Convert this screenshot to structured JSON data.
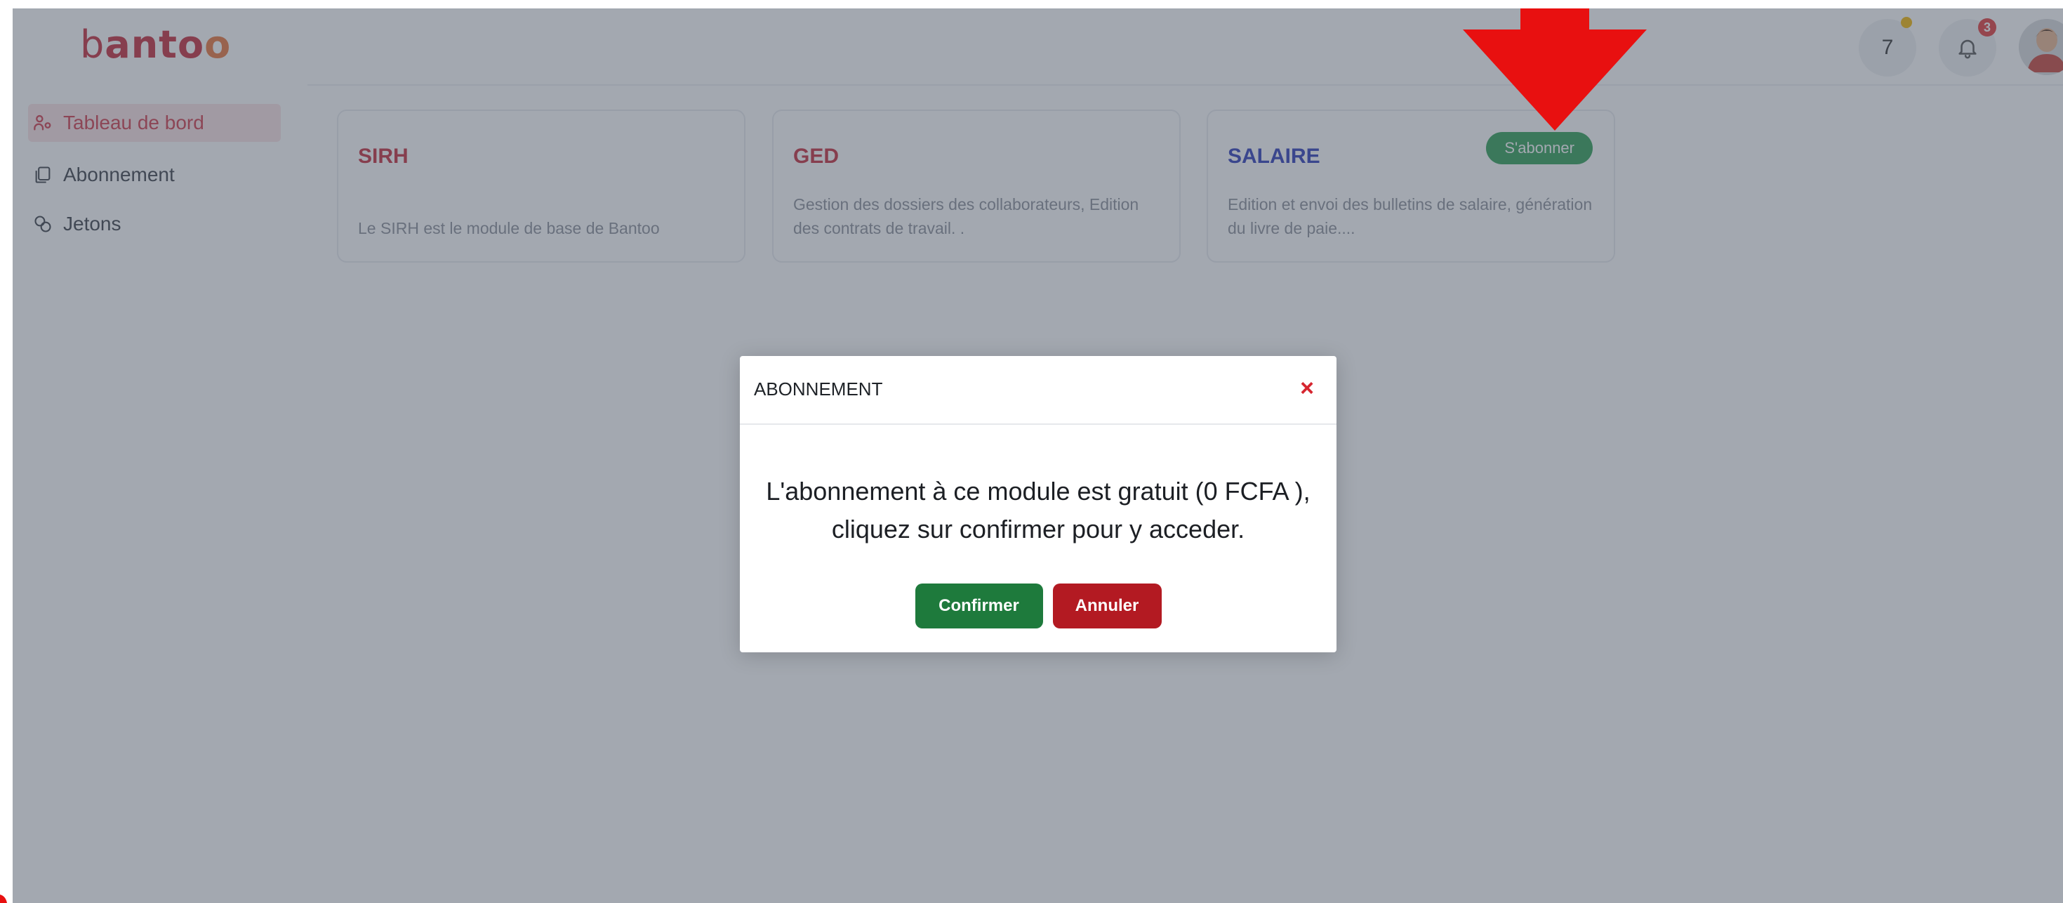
{
  "logo": {
    "text_b": "b",
    "text_mid": "anto",
    "text_o": "o"
  },
  "header": {
    "tokens_count": "7",
    "notifications_count": "3"
  },
  "sidebar": {
    "items": [
      {
        "label": "Tableau de bord",
        "icon": "users-icon",
        "active": true
      },
      {
        "label": "Abonnement",
        "icon": "copy-icon",
        "active": false
      },
      {
        "label": "Jetons",
        "icon": "coins-icon",
        "active": false
      }
    ]
  },
  "modules": [
    {
      "title": "SIRH",
      "title_color": "#c42b3a",
      "description": "Le SIRH est le module de base de Bantoo"
    },
    {
      "title": "GED",
      "title_color": "#c42b3a",
      "description": "Gestion des dossiers des collaborateurs, Edition des contrats de travail. ."
    },
    {
      "title": "SALAIRE",
      "title_color": "#2c3ab8",
      "description": "Edition et envoi des bulletins de salaire, génération du livre de paie....",
      "action_label": "S'abonner"
    }
  ],
  "modal": {
    "title": "ABONNEMENT",
    "close_symbol": "×",
    "message_line1": "L'abonnement à ce module est gratuit (0 FCFA ),",
    "message_line2": "cliquez sur confirmer pour y acceder.",
    "confirm_label": "Confirmer",
    "cancel_label": "Annuler"
  },
  "colors": {
    "brand": "#c42b3a",
    "subscribe_green": "#2e9e54",
    "confirm_green": "#1e7a3c",
    "cancel_red": "#b31a22",
    "annotation_arrow": "#e81010"
  }
}
